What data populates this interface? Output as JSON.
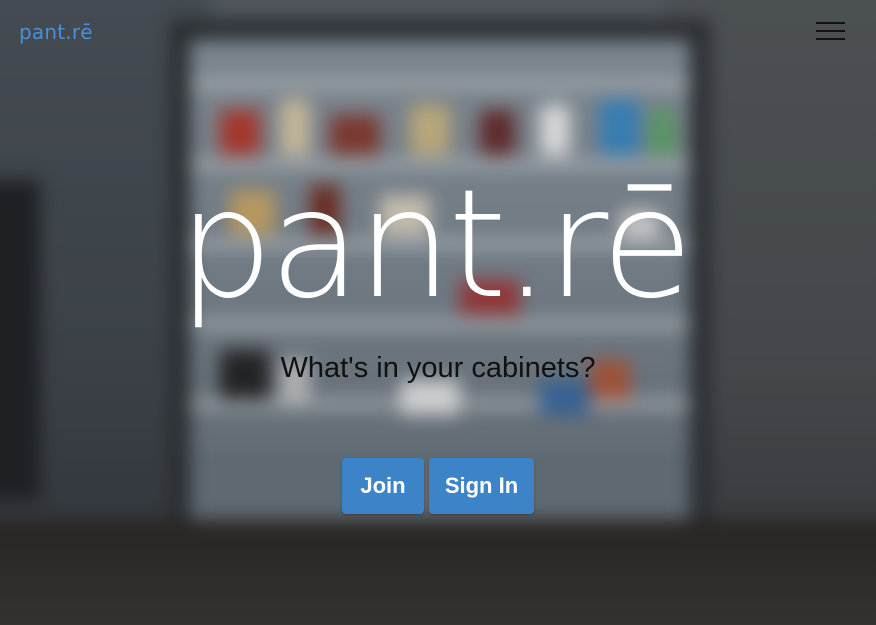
{
  "header": {
    "logo_text": "pant.rē",
    "menu_icon": "hamburger-menu-icon"
  },
  "hero": {
    "title": "pant.rē",
    "tagline": "What's in your cabinets?"
  },
  "actions": {
    "join_label": "Join",
    "signin_label": "Sign In"
  },
  "colors": {
    "accent": "#3d83c8",
    "logo": "#4a90d9"
  }
}
